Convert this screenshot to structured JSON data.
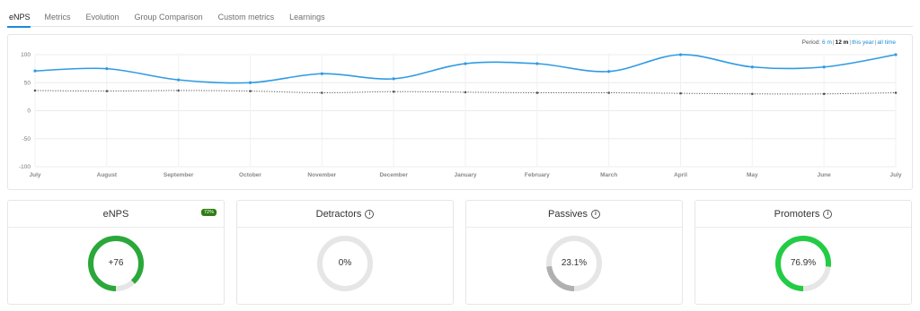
{
  "tabs": [
    {
      "label": "eNPS",
      "active": true
    },
    {
      "label": "Metrics",
      "active": false
    },
    {
      "label": "Evolution",
      "active": false
    },
    {
      "label": "Group Comparison",
      "active": false
    },
    {
      "label": "Custom metrics",
      "active": false
    },
    {
      "label": "Learnings",
      "active": false
    }
  ],
  "period": {
    "label": "Period:",
    "options": [
      "6 m",
      "12 m",
      "this year",
      "all time"
    ],
    "selected": "12 m"
  },
  "chart_data": {
    "type": "line",
    "categories": [
      "July",
      "August",
      "September",
      "October",
      "November",
      "December",
      "January",
      "February",
      "March",
      "April",
      "May",
      "June",
      "July"
    ],
    "ylim": [
      -100,
      100
    ],
    "yticks": [
      "100",
      "50",
      "0",
      "-50",
      "-100"
    ],
    "grid": true,
    "series": [
      {
        "values": [
          71,
          75,
          55,
          50,
          66,
          57,
          84,
          84,
          70,
          100,
          78,
          78,
          100
        ],
        "color": "#2f9be3",
        "style": "solid"
      },
      {
        "values": [
          36,
          35,
          36,
          35,
          32,
          34,
          33,
          32,
          32,
          31,
          30,
          30,
          32
        ],
        "color": "#555555",
        "style": "dotted"
      }
    ]
  },
  "cards": [
    {
      "title": "eNPS",
      "value": "+76",
      "badge": "72%",
      "info": false,
      "fill": 0.88,
      "color": "#2aa83a"
    },
    {
      "title": "Detractors",
      "value": "0%",
      "info": true,
      "fill": 0.0,
      "color": "#2aa83a"
    },
    {
      "title": "Passives",
      "value": "23.1%",
      "info": true,
      "fill": 0.231,
      "color": "#b0b0b0"
    },
    {
      "title": "Promoters",
      "value": "76.9%",
      "info": true,
      "fill": 0.769,
      "color": "#22cc44"
    }
  ],
  "icons": {
    "info": "i"
  }
}
